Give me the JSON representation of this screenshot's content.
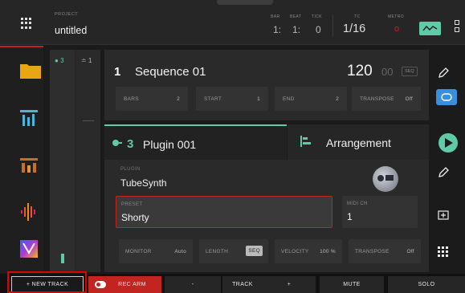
{
  "header": {
    "project_label": "PROJECT",
    "project_name": "untitled",
    "bar_label": "BAR",
    "beat_label": "BEAT",
    "tick_label": "TICK",
    "bar_value": "1:",
    "beat_value": "1:",
    "tick_value": "0",
    "tc_label": "TC",
    "tc_value": "1/16",
    "metro_label": "METRO",
    "metro_value": "o"
  },
  "track_strip": {
    "track_a": "3",
    "track_b": "1"
  },
  "sequence": {
    "number": "1",
    "name": "Sequence 01",
    "bpm": "120",
    "bpm_fraction": "00",
    "badge": "SEQ",
    "params": [
      {
        "label": "BARS",
        "value": "2"
      },
      {
        "label": "START",
        "value": "1"
      },
      {
        "label": "END",
        "value": "2"
      },
      {
        "label": "TRANSPOSE",
        "value": "Off"
      }
    ]
  },
  "track": {
    "number": "3",
    "name": "Plugin 001",
    "arrangement_label": "Arrangement"
  },
  "plugin": {
    "plugin_label": "PLUGIN",
    "plugin_value": "TubeSynth",
    "preset_label": "PRESET",
    "preset_value": "Shorty",
    "midi_label": "MIDI CH",
    "midi_value": "1",
    "params": [
      {
        "label": "MONITOR",
        "value": "Auto"
      },
      {
        "label": "LENGTH",
        "value": "SEQ"
      },
      {
        "label": "VELOCITY",
        "value": "100 %"
      },
      {
        "label": "TRANSPOSE",
        "value": "Off"
      }
    ]
  },
  "bottom": {
    "new_track": "+   NEW TRACK",
    "rec_arm": "REC ARM",
    "minus": "-",
    "track": "TRACK",
    "plus": "+",
    "mute": "MUTE",
    "solo": "SOLO"
  },
  "colors": {
    "accent": "#5fcaa8",
    "record": "#c2241f",
    "highlight": "#e00000",
    "loop_button": "#3a8fdc"
  }
}
